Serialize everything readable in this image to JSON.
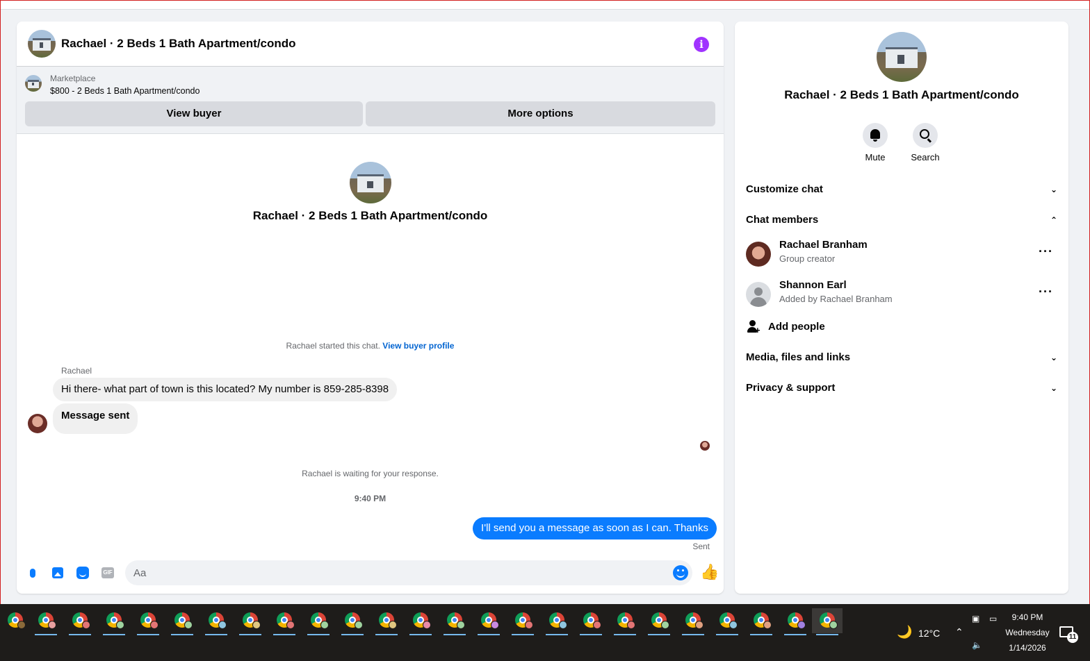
{
  "header": {
    "title": "Rachael · 2 Beds 1 Bath Apartment/condo",
    "info_icon": "info-icon"
  },
  "marketplace": {
    "label": "Marketplace",
    "listing": "$800 - 2 Beds 1 Bath Apartment/condo",
    "view_buyer_label": "View buyer",
    "more_options_label": "More options"
  },
  "conversation": {
    "intro_title": "Rachael · 2 Beds 1 Bath Apartment/condo",
    "started_text": "Rachael started this chat.",
    "view_profile_link": "View buyer profile",
    "sender_name": "Rachael",
    "messages_in": [
      "Hi there- what part of town is this located? My number is 859-285-8398",
      "Message sent"
    ],
    "waiting_text": "Rachael is waiting for your response.",
    "timestamp": "9:40 PM",
    "message_out": "I'll send you a message as soon as I can. Thanks",
    "status": "Sent"
  },
  "composer": {
    "placeholder": "Aa",
    "gif_label": "GIF"
  },
  "details": {
    "title": "Rachael · 2 Beds 1 Bath Apartment/condo",
    "mute_label": "Mute",
    "search_label": "Search",
    "customize_chat": "Customize chat",
    "chat_members": "Chat members",
    "members": [
      {
        "name": "Rachael Branham",
        "subtitle": "Group creator"
      },
      {
        "name": "Shannon Earl",
        "subtitle": "Added by Rachael Branham"
      }
    ],
    "add_people": "Add people",
    "media_files_links": "Media, files and links",
    "privacy_support": "Privacy & support"
  },
  "taskbar": {
    "temperature": "12°C",
    "time": "9:40 PM",
    "day": "Wednesday",
    "date": "1/14/2026",
    "notification_count": "11"
  },
  "colors": {
    "accent": "#0a7cff",
    "info": "#a033ff",
    "taskbar": "#1e1c1a"
  }
}
